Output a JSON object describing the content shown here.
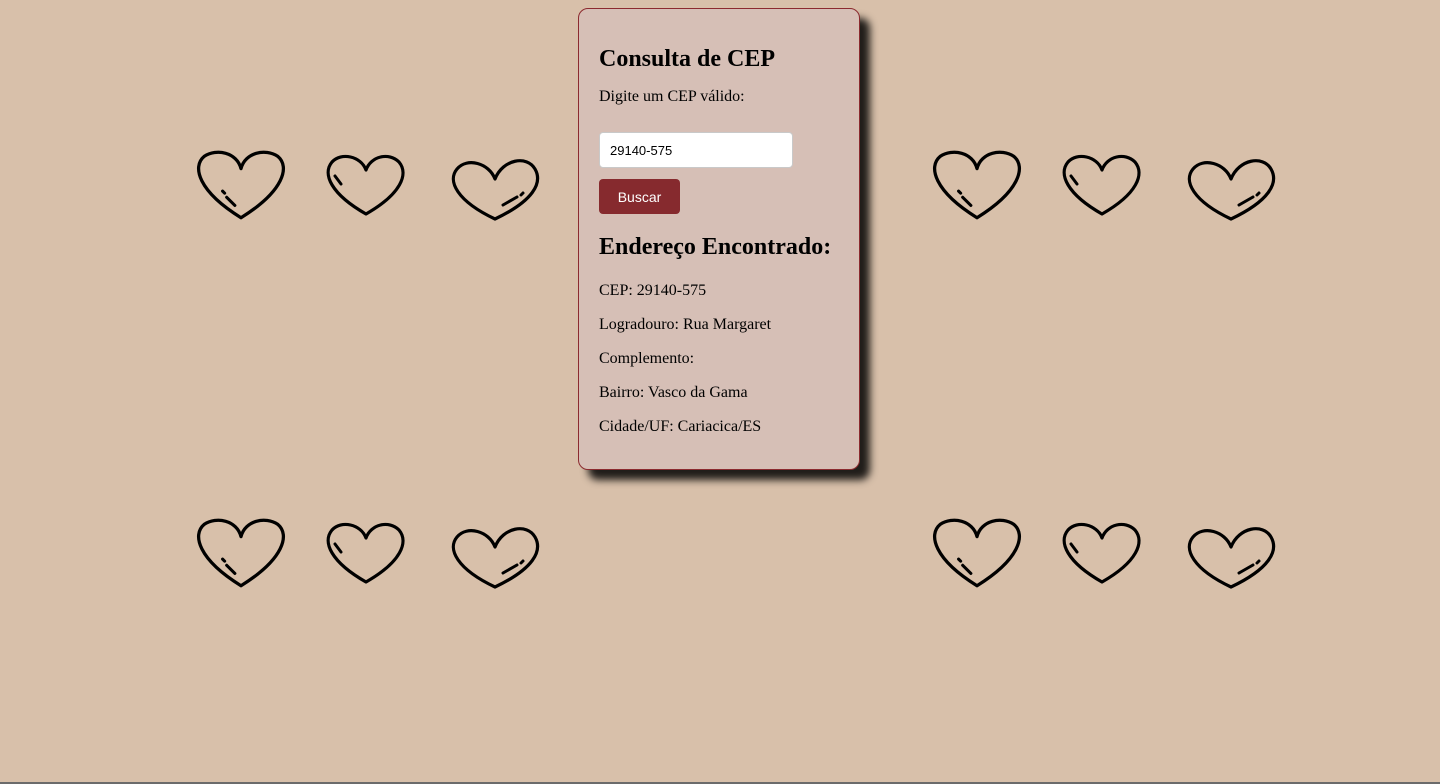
{
  "page": {
    "background_color": "#d8c0aa",
    "card_background": "#d6bfb6",
    "button_color": "#862a2e",
    "decoration_icon": "heart-outline-icon"
  },
  "form": {
    "title": "Consulta de CEP",
    "prompt": "Digite um CEP válido:",
    "cep_value": "29140-575",
    "search_label": "Buscar"
  },
  "result": {
    "title": "Endereço Encontrado:",
    "cep_line": "CEP: 29140-575",
    "logradouro_line": "Logradouro: Rua Margaret",
    "complemento_line": "Complemento:",
    "bairro_line": "Bairro: Vasco da Gama",
    "cidade_line": "Cidade/UF: Cariacica/ES"
  }
}
